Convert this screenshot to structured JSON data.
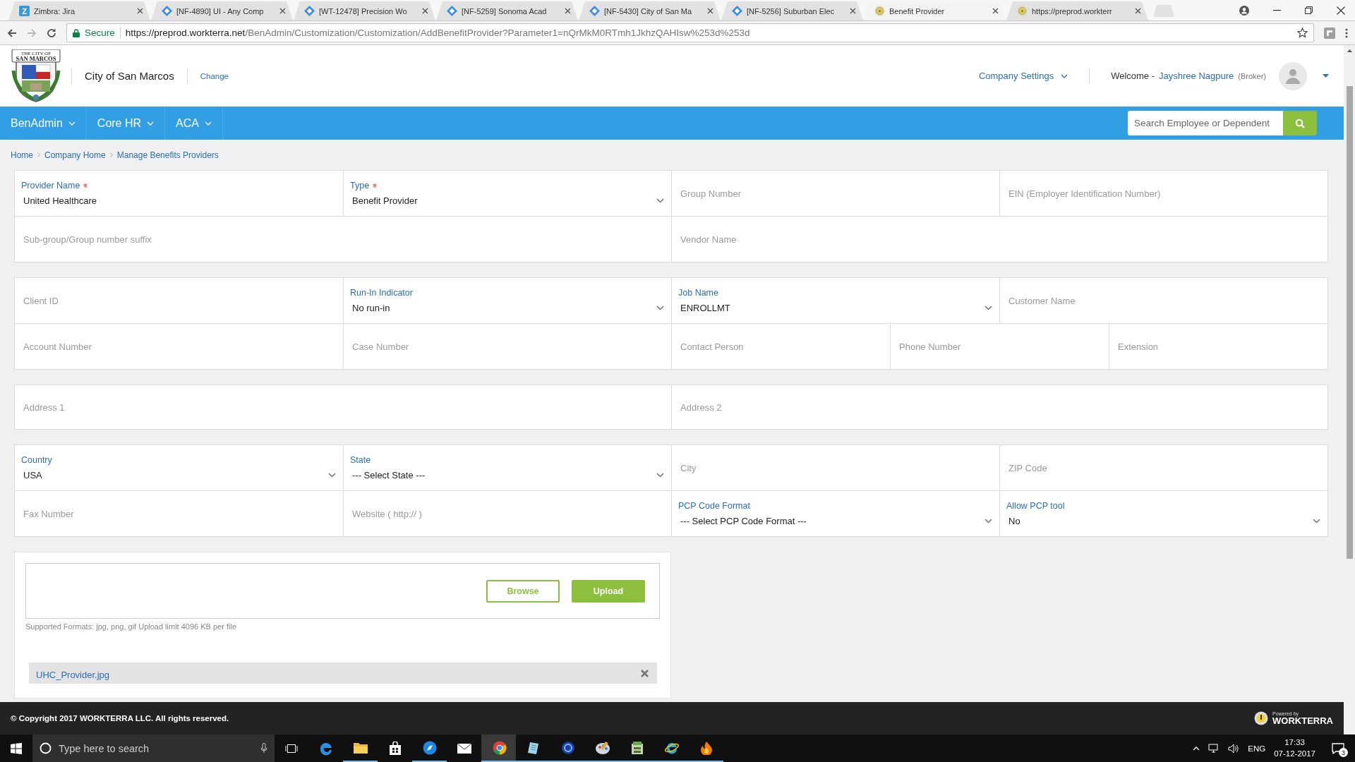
{
  "browser": {
    "tabs": [
      {
        "title": "Zimbra: Jira",
        "kind": "letter",
        "letter": "Z",
        "selected": false
      },
      {
        "title": "[NF-4890] UI - Any Comp",
        "kind": "diamond",
        "selected": false
      },
      {
        "title": "[WT-12478] Precision Wo",
        "kind": "diamond",
        "selected": false
      },
      {
        "title": "[NF-5259] Sonoma Acad",
        "kind": "diamond",
        "selected": false
      },
      {
        "title": "[NF-5430] City of San Ma",
        "kind": "diamond",
        "selected": false
      },
      {
        "title": "[NF-5256] Suburban Elec",
        "kind": "diamond",
        "selected": false
      },
      {
        "title": "Benefit Provider",
        "kind": "seal",
        "selected": true
      },
      {
        "title": "https://preprod.workterr",
        "kind": "seal",
        "selected": false
      }
    ],
    "address": {
      "secure_label": "Secure",
      "host": "https://preprod.workterra.net",
      "path": "/BenAdmin/Customization/Customization/AddBenefitProvider?Parameter1=nQrMkM0RTmh1JkhzQAHIsw%253d%253d"
    }
  },
  "header": {
    "logo_lines": [
      "THE CITY OF",
      "SAN MARCOS"
    ],
    "company": "City of San Marcos",
    "change_link": "Change",
    "settings_menu": "Company Settings",
    "welcome": "Welcome -",
    "user_name": "Jayshree Nagpure",
    "user_role": "(Broker)"
  },
  "nav": {
    "items": [
      {
        "label": "BenAdmin"
      },
      {
        "label": "Core HR"
      },
      {
        "label": "ACA"
      }
    ],
    "search": {
      "placeholder": "Search Employee or Dependent"
    }
  },
  "breadcrumb": [
    "Home",
    "Company Home",
    "Manage Benefits Providers"
  ],
  "sections": [
    {
      "lines": [
        {
          "fields": [
            {
              "kind": "input",
              "label": "Provider Name",
              "required": true,
              "value": "United Healthcare"
            },
            {
              "kind": "select",
              "label": "Type",
              "required": true,
              "value": "Benefit Provider"
            },
            {
              "kind": "input",
              "placeholder": "Group Number"
            },
            {
              "kind": "input",
              "placeholder": "EIN (Employer Identification Number)"
            }
          ]
        },
        {
          "fields": [
            {
              "kind": "input",
              "placeholder": "Sub-group/Group number suffix"
            },
            {
              "kind": "input",
              "placeholder": "Vendor Name"
            }
          ]
        }
      ]
    },
    {
      "lines": [
        {
          "fields": [
            {
              "kind": "input",
              "placeholder": "Client ID"
            },
            {
              "kind": "select",
              "label": "Run-In Indicator",
              "value": "No run-in"
            },
            {
              "kind": "select",
              "label": "Job Name",
              "value": "ENROLLMT"
            },
            {
              "kind": "input",
              "placeholder": "Customer Name"
            }
          ]
        },
        {
          "fields": [
            {
              "kind": "input",
              "placeholder": "Account Number"
            },
            {
              "kind": "input",
              "placeholder": "Case Number"
            },
            {
              "kind": "input",
              "placeholder": "Contact Person"
            },
            {
              "kind": "input",
              "placeholder": "Phone Number"
            },
            {
              "kind": "input",
              "placeholder": "Extension"
            }
          ]
        }
      ]
    },
    {
      "lines": [
        {
          "fields": [
            {
              "kind": "input",
              "placeholder": "Address 1"
            },
            {
              "kind": "input",
              "placeholder": "Address 2"
            }
          ]
        }
      ]
    },
    {
      "lines": [
        {
          "fields": [
            {
              "kind": "select",
              "label": "Country",
              "value": "USA"
            },
            {
              "kind": "select",
              "label": "State",
              "value": "--- Select State ---"
            },
            {
              "kind": "input",
              "placeholder": "City"
            },
            {
              "kind": "input",
              "placeholder": "ZIP Code"
            }
          ]
        },
        {
          "fields": [
            {
              "kind": "input",
              "placeholder": "Fax Number"
            },
            {
              "kind": "input",
              "placeholder": "Website ( http:// )"
            },
            {
              "kind": "select",
              "label": "PCP Code Format",
              "value": "--- Select PCP Code Format ---"
            },
            {
              "kind": "select",
              "label": "Allow PCP tool",
              "value": "No"
            }
          ]
        }
      ]
    }
  ],
  "upload": {
    "browse_button": "Browse",
    "upload_button": "Upload",
    "help": "Supported Formats: jpg, png, gif Upload limit 4096 KB per file",
    "files": [
      "UHC_Provider.jpg"
    ]
  },
  "footer": {
    "copyright": "© Copyright 2017 WORKTERRA LLC. All rights reserved.",
    "powered_by": "Powered by",
    "brand": "WORKTERRA"
  },
  "taskbar": {
    "search_placeholder": "Type here to search",
    "apps": [
      {
        "kind": "edge",
        "running": false,
        "selected": false
      },
      {
        "kind": "folder",
        "running": true,
        "selected": false
      },
      {
        "kind": "store",
        "running": false,
        "selected": false
      },
      {
        "kind": "compass",
        "running": true,
        "selected": false
      },
      {
        "kind": "mail",
        "running": false,
        "selected": false
      },
      {
        "kind": "chrome",
        "running": true,
        "selected": true
      },
      {
        "kind": "notebook",
        "running": true,
        "selected": false
      },
      {
        "kind": "orb",
        "running": true,
        "selected": false
      },
      {
        "kind": "palette",
        "running": true,
        "selected": false
      },
      {
        "kind": "archive",
        "running": true,
        "selected": false
      },
      {
        "kind": "ie",
        "running": true,
        "selected": false
      },
      {
        "kind": "flame",
        "running": true,
        "selected": false
      }
    ],
    "language": "ENG",
    "time": "17:33",
    "date": "07-12-2017",
    "notifications": "3"
  }
}
